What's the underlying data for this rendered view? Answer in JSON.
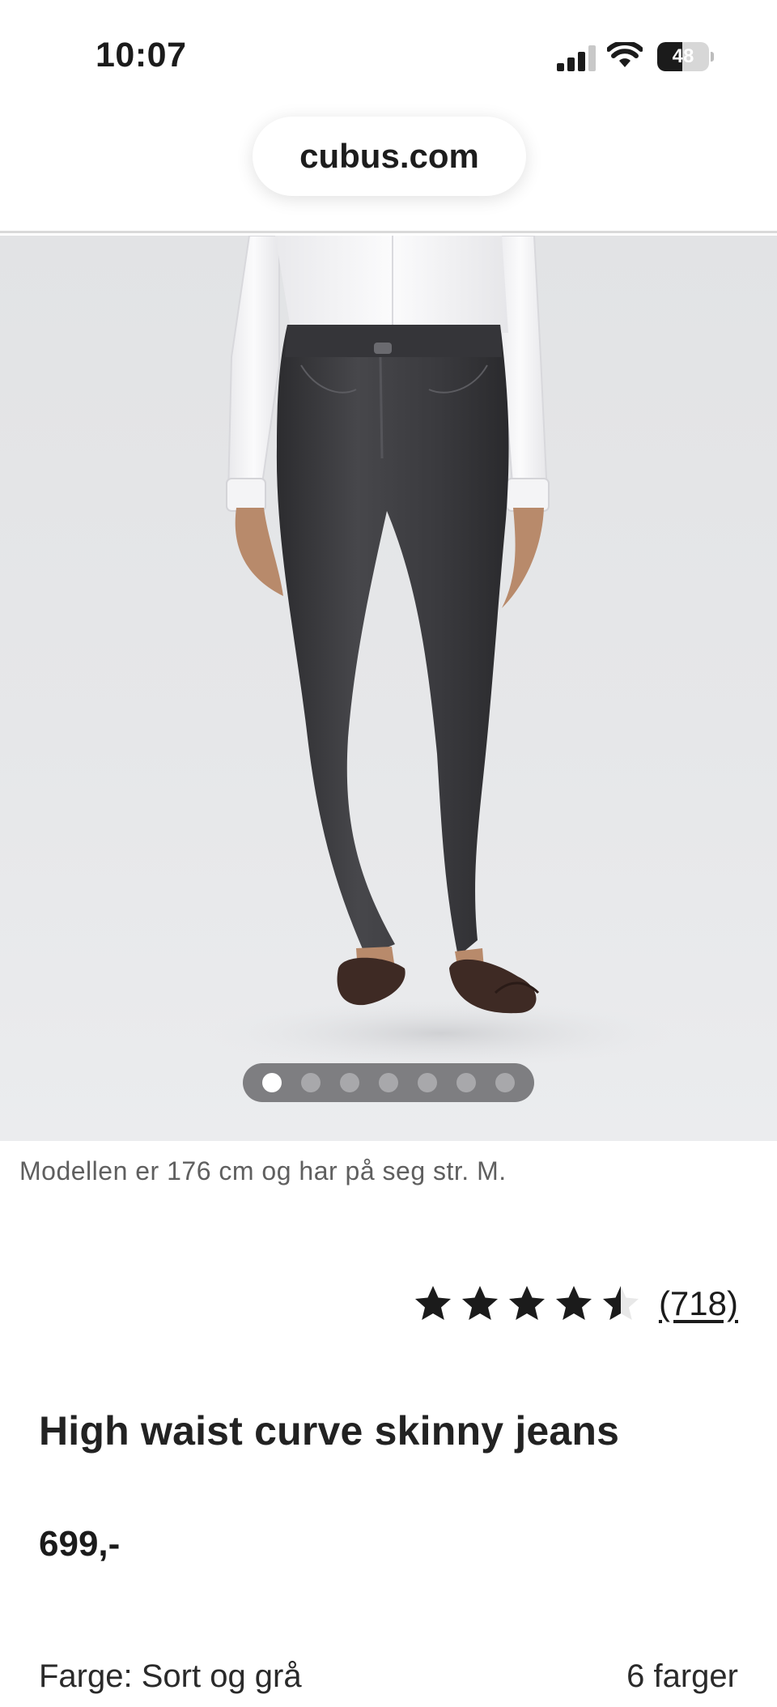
{
  "status_bar": {
    "time": "10:07",
    "battery_level": "48",
    "battery_fraction": 0.48
  },
  "browser": {
    "url": "cubus.com"
  },
  "gallery": {
    "image_count": 7,
    "active_index": 0
  },
  "product": {
    "model_info": "Modellen er 176 cm og har på seg str. M.",
    "rating": 4.5,
    "rating_max": 5,
    "review_count": "(718)",
    "title": "High waist curve skinny jeans",
    "price": "699,-",
    "color_label": "Farge: Sort og grå",
    "color_count": "6 farger"
  },
  "colors": {
    "text": "#1b1b1b",
    "muted": "#5f5f5f",
    "star": "#1b1b1b"
  }
}
